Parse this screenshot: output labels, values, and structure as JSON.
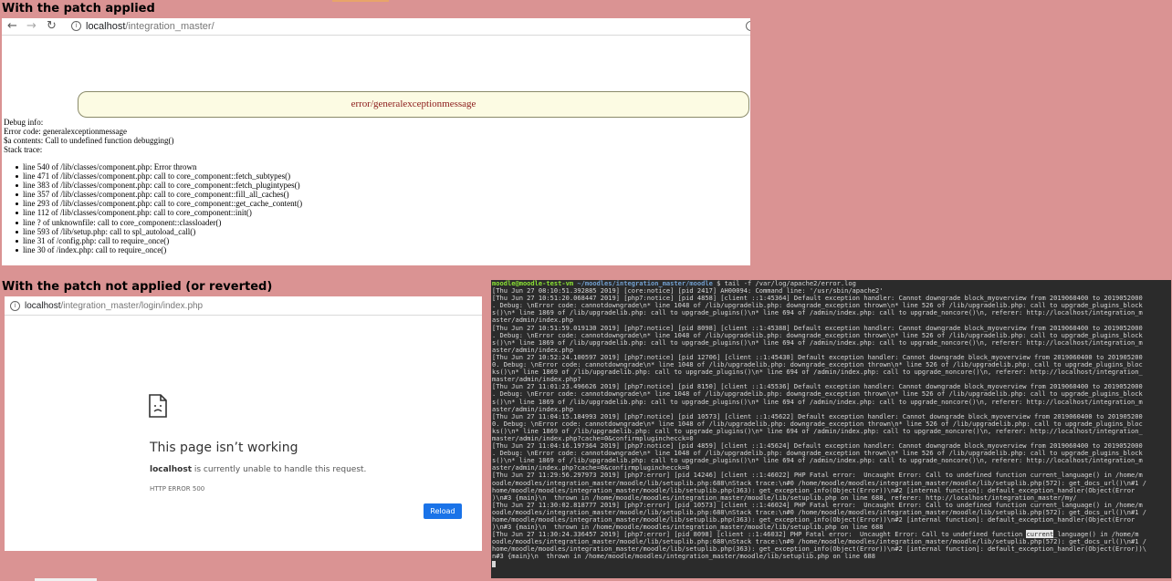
{
  "headings": {
    "applied": "With the patch applied",
    "not_applied": "With the patch not applied (or reverted)"
  },
  "top_browser": {
    "url_host": "localhost",
    "url_path": "/integration_master/",
    "error_message": "error/generalexceptionmessage",
    "debug_lines": [
      "Debug info:",
      "Error code: generalexceptionmessage",
      "$a contents: Call to undefined function debugging()",
      "Stack trace:"
    ],
    "stack_trace": [
      "line 540 of /lib/classes/component.php: Error thrown",
      "line 471 of /lib/classes/component.php: call to core_component::fetch_subtypes()",
      "line 383 of /lib/classes/component.php: call to core_component::fetch_plugintypes()",
      "line 357 of /lib/classes/component.php: call to core_component::fill_all_caches()",
      "line 293 of /lib/classes/component.php: call to core_component::get_cache_content()",
      "line 112 of /lib/classes/component.php: call to core_component::init()",
      "line ? of unknownfile: call to core_component::classloader()",
      "line 593 of /lib/setup.php: call to spl_autoload_call()",
      "line 31 of /config.php: call to require_once()",
      "line 30 of /index.php: call to require_once()"
    ]
  },
  "bottom_browser": {
    "url_host": "localhost",
    "url_path": "/integration_master/login/index.php",
    "title": "This page isn’t working",
    "message_host": "localhost",
    "message_rest": " is currently unable to handle this request.",
    "error_code": "HTTP ERROR 500",
    "reload_label": "Reload"
  },
  "terminal": {
    "prompt_user": "moodle@moodle-test-vm",
    "prompt_path": " ~/moodles/integration_master/moodle",
    "prompt_cmd": " $ tail -f /var/log/apache2/error.log",
    "lines": [
      "[Thu Jun 27 08:10:51.392885 2019] [core:notice] [pid 2417] AH00094: Command line: '/usr/sbin/apache2'",
      "[Thu Jun 27 10:51:20.068447 2019] [php7:notice] [pid 4858] [client ::1:45364] Default exception handler: Cannot downgrade block_myoverview from 2019060400 to 2019052000",
      ". Debug: \\nError code: cannotdowngrade\\n* line 1048 of /lib/upgradelib.php: downgrade_exception thrown\\n* line 526 of /lib/upgradelib.php: call to upgrade_plugins_block",
      "s()\\n* line 1869 of /lib/upgradelib.php: call to upgrade_plugins()\\n* line 694 of /admin/index.php: call to upgrade_noncore()\\n, referer: http://localhost/integration_m",
      "aster/admin/index.php",
      "[Thu Jun 27 10:51:59.019130 2019] [php7:notice] [pid 8098] [client ::1:45388] Default exception handler: Cannot downgrade block_myoverview from 2019060400 to 2019052000",
      ". Debug: \\nError code: cannotdowngrade\\n* line 1048 of /lib/upgradelib.php: downgrade_exception thrown\\n* line 526 of /lib/upgradelib.php: call to upgrade_plugins_block",
      "s()\\n* line 1869 of /lib/upgradelib.php: call to upgrade_plugins()\\n* line 694 of /admin/index.php: call to upgrade_noncore()\\n, referer: http://localhost/integration_m",
      "aster/admin/index.php",
      "[Thu Jun 27 10:52:24.100597 2019] [php7:notice] [pid 12706] [client ::1:45430] Default exception handler: Cannot downgrade block_myoverview from 2019060400 to 201905200",
      "0. Debug: \\nError code: cannotdowngrade\\n* line 1048 of /lib/upgradelib.php: downgrade_exception thrown\\n* line 526 of /lib/upgradelib.php: call to upgrade_plugins_bloc",
      "ks()\\n* line 1869 of /lib/upgradelib.php: call to upgrade_plugins()\\n* line 694 of /admin/index.php: call to upgrade_noncore()\\n, referer: http://localhost/integration_",
      "master/admin/index.php?",
      "[Thu Jun 27 11:01:23.496626 2019] [php7:notice] [pid 8150] [client ::1:45536] Default exception handler: Cannot downgrade block_myoverview from 2019060400 to 2019052000",
      ". Debug: \\nError code: cannotdowngrade\\n* line 1048 of /lib/upgradelib.php: downgrade_exception thrown\\n* line 526 of /lib/upgradelib.php: call to upgrade_plugins_block",
      "s()\\n* line 1869 of /lib/upgradelib.php: call to upgrade_plugins()\\n* line 694 of /admin/index.php: call to upgrade_noncore()\\n, referer: http://localhost/integration_m",
      "aster/admin/index.php",
      "[Thu Jun 27 11:04:15.184993 2019] [php7:notice] [pid 10573] [client ::1:45622] Default exception handler: Cannot downgrade block_myoverview from 2019060400 to 201905200",
      "0. Debug: \\nError code: cannotdowngrade\\n* line 1048 of /lib/upgradelib.php: downgrade_exception thrown\\n* line 526 of /lib/upgradelib.php: call to upgrade_plugins_bloc",
      "ks()\\n* line 1869 of /lib/upgradelib.php: call to upgrade_plugins()\\n* line 694 of /admin/index.php: call to upgrade_noncore()\\n, referer: http://localhost/integration_",
      "master/admin/index.php?cache=0&confirmpluginchecck=0",
      "[Thu Jun 27 11:04:16.197364 2019] [php7:notice] [pid 4859] [client ::1:45624] Default exception handler: Cannot downgrade block_myoverview from 2019060400 to 2019052000",
      ". Debug: \\nError code: cannotdowngrade\\n* line 1048 of /lib/upgradelib.php: downgrade_exception thrown\\n* line 526 of /lib/upgradelib.php: call to upgrade_plugins_block",
      "s()\\n* line 1869 of /lib/upgradelib.php: call to upgrade_plugins()\\n* line 694 of /admin/index.php: call to upgrade_noncore()\\n, referer: http://localhost/integration_m",
      "aster/admin/index.php?cache=0&confirmpluginchecck=0",
      "[Thu Jun 27 11:29:56.297973 2019] [php7:error] [pid 14246] [client ::1:46022] PHP Fatal error:  Uncaught Error: Call to undefined function current_language() in /home/m",
      "oodle/moodles/integration_master/moodle/lib/setuplib.php:688\\nStack trace:\\n#0 /home/moodle/moodles/integration_master/moodle/lib/setuplib.php(572): get_docs_url()\\n#1 /",
      "home/moodle/moodles/integration_master/moodle/lib/setuplib.php(363): get_exception_info(Object(Error))\\n#2 [internal function]: default_exception_handler(Object(Error",
      ")\\n#3 {main}\\n  thrown in /home/moodle/moodles/integration_master/moodle/lib/setuplib.php on line 688, referer: http://localhost/integration_master/my/",
      "[Thu Jun 27 11:30:02.818777 2019] [php7:error] [pid 10573] [client ::1:46024] PHP Fatal error:  Uncaught Error: Call to undefined function current_language() in /home/m",
      "oodle/moodles/integration_master/moodle/lib/setuplib.php:688\\nStack trace:\\n#0 /home/moodle/moodles/integration_master/moodle/lib/setuplib.php(572): get_docs_url()\\n#1 /",
      "home/moodle/moodles/integration_master/moodle/lib/setuplib.php(363): get_exception_info(Object(Error))\\n#2 [internal function]: default_exception_handler(Object(Error",
      ")\\n#3 {main}\\n  thrown in /home/moodle/moodles/integration_master/moodle/lib/setuplib.php on line 688"
    ],
    "last_pre": "[Thu Jun 27 11:30:24.336457 2019] [php7:error] [pid 8098] [client ::1:46032] PHP Fatal error:  Uncaught Error: Call to undefined function ",
    "last_hl": "current",
    "last_post": "_language() in /home/m",
    "tail_lines": [
      "oodle/moodles/integration_master/moodle/lib/setuplib.php:688\\nStack trace:\\n#0 /home/moodle/moodles/integration_master/moodle/lib/setuplib.php(572): get_docs_url()\\n#1 /",
      "home/moodle/moodles/integration_master/moodle/lib/setuplib.php(363): get_exception_info(Object(Error))\\n#2 [internal function]: default_exception_handler(Object(Error))\\",
      "n#3 {main}\\n  thrown in /home/moodle/moodles/integration_master/moodle/lib/setuplib.php on line 688"
    ]
  }
}
